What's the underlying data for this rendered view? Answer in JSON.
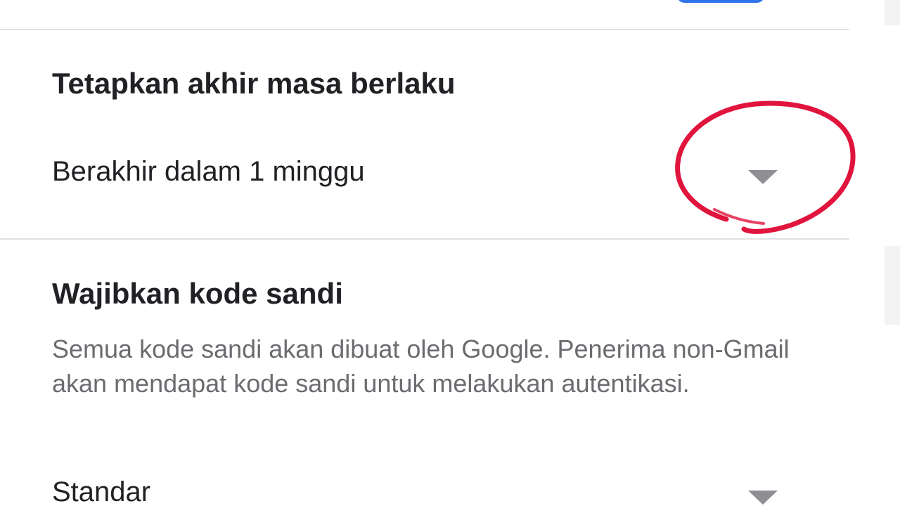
{
  "expiry": {
    "title": "Tetapkan akhir masa berlaku",
    "selected_value": "Berakhir dalam 1 minggu",
    "caret_icon": "chevron-down-icon"
  },
  "passcode": {
    "title": "Wajibkan kode sandi",
    "description": "Semua kode sandi akan dibuat oleh Google. Penerima non-Gmail akan mendapat kode sandi untuk melakukan autentikasi.",
    "selected_value": "Standar",
    "caret_icon": "chevron-down-icon"
  },
  "colors": {
    "annotation": "#e0143c",
    "accent": "#2f73e8",
    "text_primary": "#202124",
    "text_secondary": "#6b6b70",
    "divider": "#e2e2e4"
  }
}
